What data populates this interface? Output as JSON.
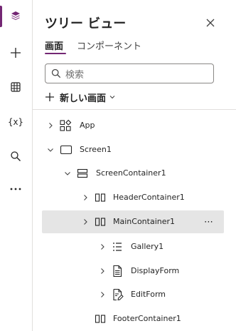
{
  "panel": {
    "title": "ツリー ビュー",
    "tabs": [
      "画面",
      "コンポーネント"
    ],
    "search_placeholder": "検索",
    "new_screen_label": "新しい画面"
  },
  "rail": {
    "items": [
      "layers-icon",
      "plus-icon",
      "table-icon",
      "variables",
      "search-icon",
      "more-icon"
    ],
    "variables_label": "{x}",
    "accent": "#742774"
  },
  "tree": {
    "items": [
      {
        "label": "App",
        "icon": "app-icon",
        "expanded": false
      },
      {
        "label": "Screen1",
        "icon": "screen-icon",
        "expanded": true
      },
      {
        "label": "ScreenContainer1",
        "icon": "vertical-container-icon",
        "expanded": true
      },
      {
        "label": "HeaderContainer1",
        "icon": "horizontal-container-icon",
        "expanded": false
      },
      {
        "label": "MainContainer1",
        "icon": "horizontal-container-icon",
        "expanded": false,
        "selected": true
      },
      {
        "label": "Gallery1",
        "icon": "gallery-icon",
        "expanded": false
      },
      {
        "label": "DisplayForm",
        "icon": "form-icon",
        "expanded": false
      },
      {
        "label": "EditForm",
        "icon": "edit-form-icon",
        "expanded": false
      },
      {
        "label": "FooterContainer1",
        "icon": "horizontal-container-icon",
        "expanded": false
      }
    ],
    "more_label": "⋯"
  }
}
